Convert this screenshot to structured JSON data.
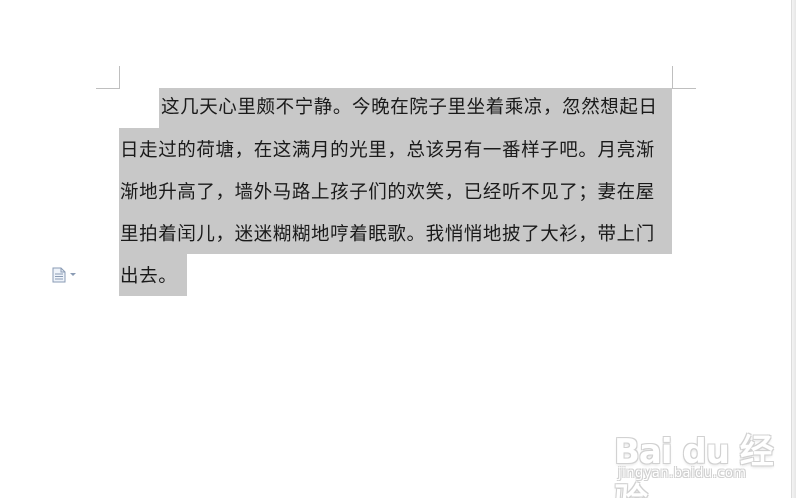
{
  "document": {
    "paragraph_lines": [
      "这几天心里颇不宁静。今晚在院子里坐着乘凉，忽然想起日",
      "日走过的荷塘，在这满月的光里，总该另有一番样子吧。月亮渐",
      "渐地升高了，墙外马路上孩子们的欢笑，已经听不见了；妻在屋",
      "里拍着闰儿，迷迷糊糊地哼着眠歌。我悄悄地披了大衫，带上门",
      "出去。"
    ],
    "selection_color": "#c8c8c8"
  },
  "side_icon": {
    "name": "document-icon",
    "has_dropdown": true
  },
  "watermark": {
    "logo_text": "Bai du 经验",
    "url_text": "jingyan.baidu.com"
  }
}
